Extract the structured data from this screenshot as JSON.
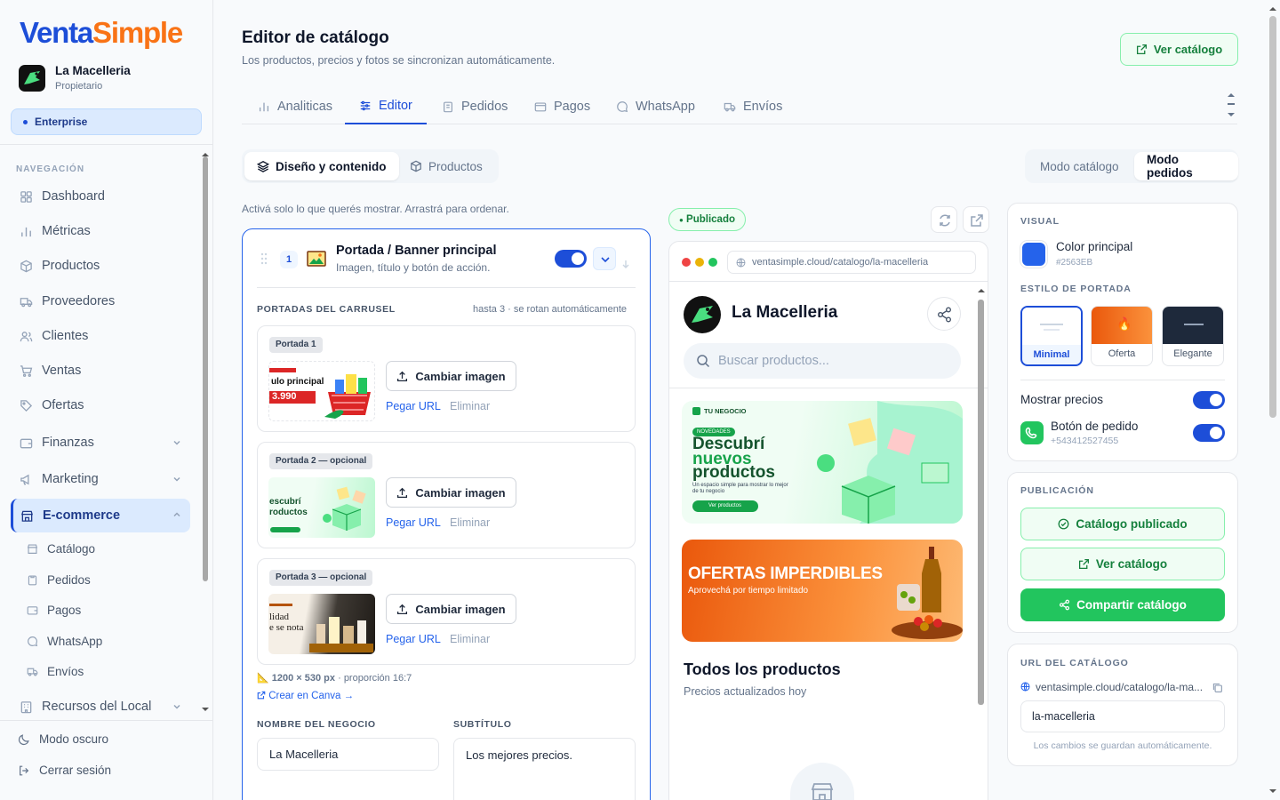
{
  "brand": {
    "logo_a": "Venta",
    "logo_b": "Simple"
  },
  "store": {
    "name": "La Macelleria",
    "role": "Propietario",
    "plan": "Enterprise"
  },
  "sidebar": {
    "section": "NAVEGACIÓN",
    "items": [
      {
        "label": "Dashboard",
        "icon": "grid-icon"
      },
      {
        "label": "Métricas",
        "icon": "bar-chart-icon"
      },
      {
        "label": "Productos",
        "icon": "box-icon"
      },
      {
        "label": "Proveedores",
        "icon": "truck-icon"
      },
      {
        "label": "Clientes",
        "icon": "users-icon"
      },
      {
        "label": "Ventas",
        "icon": "cart-icon"
      },
      {
        "label": "Ofertas",
        "icon": "tag-icon"
      },
      {
        "label": "Finanzas",
        "icon": "wallet-icon"
      },
      {
        "label": "Marketing",
        "icon": "megaphone-icon"
      },
      {
        "label": "E-commerce",
        "icon": "store-icon"
      },
      {
        "label": "Recursos del Local",
        "icon": "building-icon"
      }
    ],
    "subitems": [
      {
        "label": "Catálogo",
        "icon": "store-icon"
      },
      {
        "label": "Pedidos",
        "icon": "clipboard-icon"
      },
      {
        "label": "Pagos",
        "icon": "wallet-icon"
      },
      {
        "label": "WhatsApp",
        "icon": "chat-icon"
      },
      {
        "label": "Envíos",
        "icon": "truck-icon"
      }
    ],
    "dark_mode": "Modo oscuro",
    "logout": "Cerrar sesión"
  },
  "header": {
    "title": "Editor de catálogo",
    "subtitle": "Los productos, precios y fotos se sincronizan automáticamente.",
    "view_button": "Ver catálogo"
  },
  "tabs": [
    {
      "label": "Analiticas"
    },
    {
      "label": "Editor"
    },
    {
      "label": "Pedidos"
    },
    {
      "label": "Pagos"
    },
    {
      "label": "WhatsApp"
    },
    {
      "label": "Envíos"
    }
  ],
  "subtabs": {
    "design": "Diseño y contenido",
    "products": "Productos"
  },
  "modes": {
    "catalog": "Modo catálogo",
    "orders": "Modo pedidos"
  },
  "editor": {
    "hint": "Activá solo lo que querés mostrar. Arrastrá para ordenar.",
    "section_number": "1",
    "section_title": "Portada / Banner principal",
    "section_subtitle": "Imagen, título y botón de acción.",
    "section_enabled": true,
    "carousel_heading": "PORTADAS DEL CARRUSEL",
    "carousel_note": "hasta 3 · se rotan automáticamente",
    "covers": [
      {
        "badge": "Portada 1",
        "thumb_text": "ulo principal",
        "thumb_price": "3.990"
      },
      {
        "badge": "Portada 2 — opcional",
        "thumb_text": "escubrí",
        "thumb_text2": "roductos"
      },
      {
        "badge": "Portada 3 — opcional",
        "thumb_text": "lidad",
        "thumb_text2": "e se nota"
      }
    ],
    "change_image": "Cambiar imagen",
    "paste_url": "Pegar URL",
    "delete": "Eliminar",
    "dims": "1200 × 530 px",
    "ratio": "· proporción 16:7",
    "canva": "Crear en Canva →",
    "business_name_label": "NOMBRE DEL NEGOCIO",
    "business_name": "La Macelleria",
    "subtitle_label": "SUBTÍTULO",
    "subtitle_value": "Los mejores precios."
  },
  "preview": {
    "status": "Publicado",
    "url": "ventasimple.cloud/catalogo/la-macelleria",
    "store_name": "La Macelleria",
    "search_placeholder": "Buscar productos...",
    "banner1": {
      "kicker": "TU NEGOCIO",
      "tag": "NOVEDADES",
      "line1": "Descubrí",
      "line2": "nuevos",
      "line3": "productos",
      "body": "Un espacio simple para mostrar lo mejor de tu negocio",
      "cta": "Ver productos"
    },
    "banner2": {
      "title": "OFERTAS IMPERDIBLES",
      "subtitle": "Aprovechá por tiempo limitado"
    },
    "products_title": "Todos los productos",
    "products_subtitle": "Precios actualizados hoy"
  },
  "settings": {
    "visual_heading": "VISUAL",
    "color_label": "Color principal",
    "color_value": "#2563EB",
    "style_heading": "ESTILO DE PORTADA",
    "styles": [
      {
        "label": "Minimal",
        "selected": true
      },
      {
        "label": "Oferta",
        "selected": false
      },
      {
        "label": "Elegante",
        "selected": false
      }
    ],
    "show_prices": "Mostrar precios",
    "show_prices_on": true,
    "order_button": "Botón de pedido",
    "order_phone": "+543412527455",
    "order_button_on": true,
    "publication_heading": "PUBLICACIÓN",
    "published_button": "Catálogo publicado",
    "view_button": "Ver catálogo",
    "share_button": "Compartir catálogo",
    "url_heading": "URL DEL CATÁLOGO",
    "url_value": "ventasimple.cloud/catalogo/la-ma...",
    "slug": "la-macelleria",
    "autosave": "Los cambios se guardan automáticamente."
  },
  "colors": {
    "accent": "#1d4ed8",
    "brand_orange": "#f97316",
    "success": "#22c55e"
  }
}
